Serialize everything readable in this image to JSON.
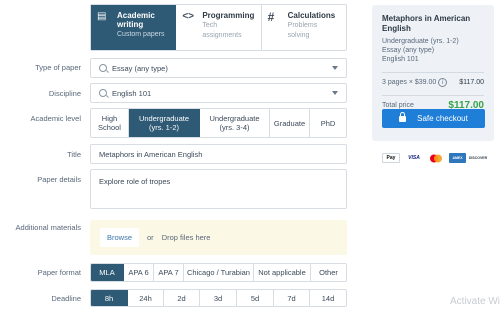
{
  "paper_types": [
    {
      "icon": "▤",
      "title_line1": "Academic",
      "title_line2": "writing",
      "subtitle": "Custom papers"
    },
    {
      "icon": "<>",
      "title_line1": "Programming",
      "subtitle_line1": "Tech",
      "subtitle_line2": "assignments"
    },
    {
      "icon": "#",
      "title_line1": "Calculations",
      "subtitle_line1": "Problems",
      "subtitle_line2": "solving"
    }
  ],
  "labels": {
    "type_of_paper": "Type of paper",
    "discipline": "Discipline",
    "academic_level": "Academic level",
    "title": "Title",
    "paper_details": "Paper details",
    "additional_materials": "Additional materials",
    "paper_format": "Paper format",
    "deadline": "Deadline"
  },
  "type_of_paper_value": "Essay (any type)",
  "discipline_value": "English 101",
  "academic_levels": [
    {
      "line1": "High",
      "line2": "School"
    },
    {
      "line1": "Undergraduate",
      "line2": "(yrs. 1-2)"
    },
    {
      "line1": "Undergraduate",
      "line2": "(yrs. 3-4)"
    },
    {
      "line1": "Graduate",
      "line2": ""
    },
    {
      "line1": "PhD",
      "line2": ""
    }
  ],
  "title_value": "Metaphors in American English",
  "paper_details_value": "Explore role of tropes",
  "upload": {
    "browse": "Browse",
    "or": "or",
    "drop": "Drop files here"
  },
  "paper_formats": [
    "MLA",
    "APA 6",
    "APA 7",
    "Chicago / Turabian",
    "Not applicable",
    "Other"
  ],
  "deadlines": [
    "8h",
    "24h",
    "2d",
    "3d",
    "5d",
    "7d",
    "14d"
  ],
  "summary": {
    "title": "Metaphors in American English",
    "level": "Undergraduate (yrs. 1-2)",
    "type": "Essay (any type)",
    "discipline": "English 101",
    "pages_label": "3 pages × $39.00",
    "pages_price": "$117.00",
    "total_label": "Total price",
    "total_price": "$117.00",
    "checkout": "Safe checkout"
  },
  "payment_methods": [
    "Pay",
    "VISA",
    "",
    "AMEX",
    "DISCOVER"
  ],
  "watermark": "Activate Wi",
  "colors": {
    "accent": "#2f5a75",
    "checkout": "#1f7fd8",
    "total": "#38a34a",
    "upload_bg": "#fbf8e6"
  }
}
